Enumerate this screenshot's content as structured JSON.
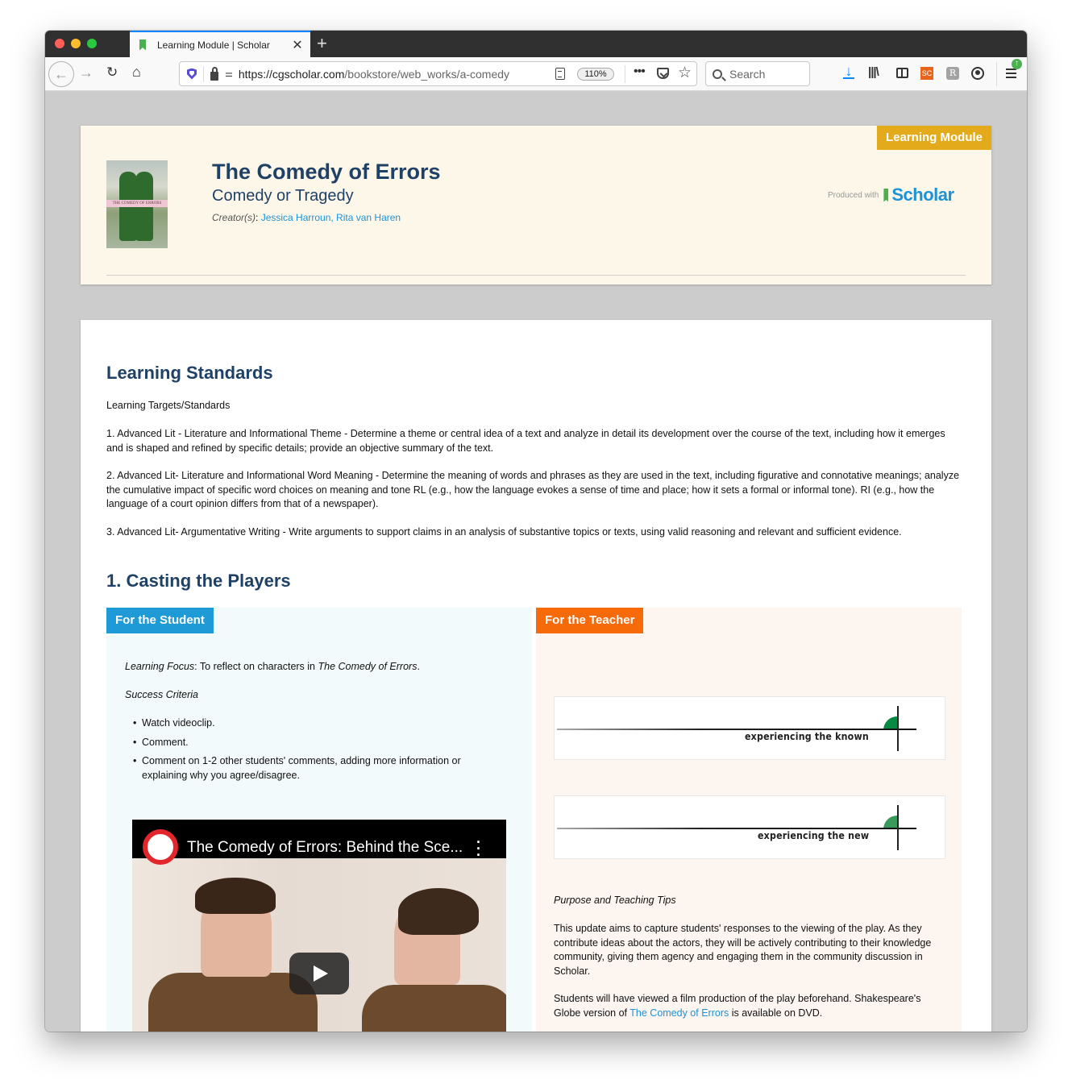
{
  "browser": {
    "tab_title": "Learning Module | Scholar",
    "url_host": "https://cgscholar.com",
    "url_path": "/bookstore/web_works/a-comedy",
    "zoom_level": "110%",
    "search_placeholder": "Search",
    "toolbar_icons": [
      "download-icon",
      "library-icon",
      "sidebar-icon",
      "sc-extension-icon",
      "r-extension-icon",
      "account-icon",
      "menu-icon"
    ],
    "sc_label": "SC",
    "r_label": "R",
    "update_badge": "↑"
  },
  "hero": {
    "badge": "Learning Module",
    "title": "The Comedy of Errors",
    "subtitle": "Comedy or Tragedy",
    "creators_label": "Creator(s)",
    "creators": "Jessica Harroun, Rita van Haren",
    "produced_with": "Produced with",
    "brand": "Scholar",
    "cover_text": "THE COMEDY OF ERRORS"
  },
  "standards": {
    "heading": "Learning Standards",
    "intro": "Learning Targets/Standards",
    "items": [
      "1. Advanced Lit - Literature and Informational Theme - Determine a theme or central idea of a text and analyze in detail its development over the course of the text, including how it emerges and is shaped and refined by specific details; provide an objective summary of the text.",
      "2. Advanced Lit- Literature and Informational Word Meaning - Determine the meaning of words and phrases as they are used in the text, including figurative and connotative meanings; analyze the cumulative impact of specific word choices on meaning and tone RL (e.g., how the language evokes a sense of time and place; how it sets a formal or informal tone). RI (e.g., how the language of a court opinion differs from that of a newspaper).",
      "3. Advanced Lit- Argumentative Writing - Write arguments to support claims in an analysis of substantive topics or texts, using valid reasoning and relevant and sufficient evidence."
    ]
  },
  "section1": {
    "heading": "1. Casting the Players",
    "student": {
      "tab": "For the Student",
      "focus_label": "Learning Focus",
      "focus_text": ": To reflect on characters in ",
      "focus_title": "The Comedy of Errors",
      "focus_end": ".",
      "criteria_label": "Success Criteria",
      "criteria": [
        "Watch videoclip.",
        "Comment.",
        "Comment on 1-2 other students' comments, adding more information or explaining why you agree/disagree."
      ],
      "video_title": "The Comedy of Errors: Behind the Sce..."
    },
    "teacher": {
      "tab": "For the Teacher",
      "diagram1_label": "experiencing the known",
      "diagram2_label": "experiencing the new",
      "tips_heading": "Purpose and Teaching Tips",
      "tips_p1": "This update aims to capture students' responses to the viewing of the play. As they contribute ideas about the actors, they will be actively contributing to their knowledge community, giving them agency and engaging them in the community discussion in Scholar.",
      "tips_p2_start": "Students will have viewed a film production of the play beforehand. Shakespeare's Globe version of ",
      "tips_p2_link": "The Comedy of Errors",
      "tips_p2_end": " is available on DVD."
    }
  },
  "colors": {
    "heading": "#1f4166",
    "link": "#1a93d8",
    "badge": "#e3ab1c",
    "student_tab": "#1e9ad6",
    "teacher_tab": "#f66a0a"
  }
}
